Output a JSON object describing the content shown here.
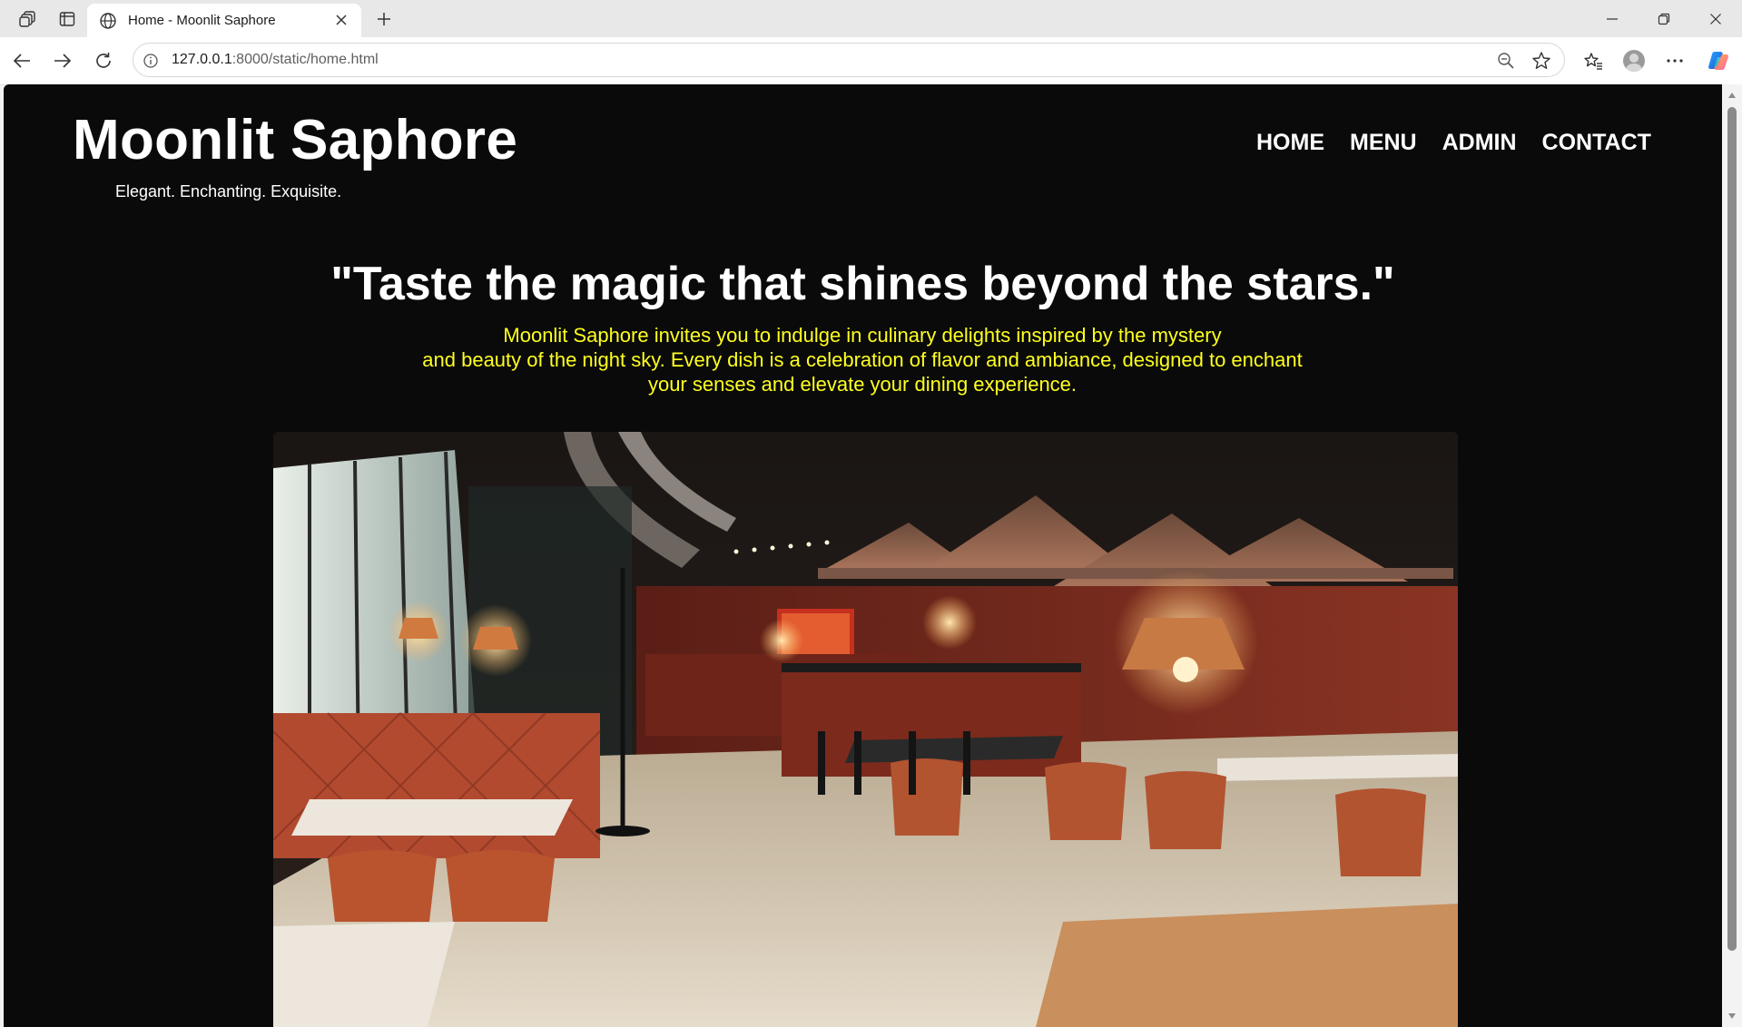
{
  "browser": {
    "tab_title": "Home - Moonlit Saphore",
    "url_host": "127.0.0.1",
    "url_path": ":8000/static/home.html"
  },
  "site": {
    "brand": "Moonlit Saphore",
    "tagline": "Elegant. Enchanting. Exquisite.",
    "nav": [
      "HOME",
      "MENU",
      "ADMIN",
      "CONTACT"
    ]
  },
  "hero": {
    "quote": "\"Taste the magic that shines beyond the stars.\"",
    "description_lines": [
      "Moonlit Saphore invites you to indulge in culinary delights inspired by the mystery",
      "and beauty of the night sky. Every dish is a celebration of flavor and ambiance, designed to enchant",
      "your senses and elevate your dining experience."
    ]
  },
  "colors": {
    "page_background": "#0a0a0a",
    "text": "#ffffff",
    "accent_text": "#ffff1f"
  },
  "icons": {
    "browser": [
      "workspaces-icon",
      "tab-actions-icon",
      "globe-icon",
      "close-icon",
      "plus-icon",
      "minimize-icon",
      "restore-icon",
      "window-close-icon",
      "back-icon",
      "forward-icon",
      "refresh-icon",
      "info-icon",
      "zoom-out-icon",
      "star-icon",
      "favorites-icon",
      "avatar",
      "more-icon",
      "copilot-icon"
    ]
  }
}
